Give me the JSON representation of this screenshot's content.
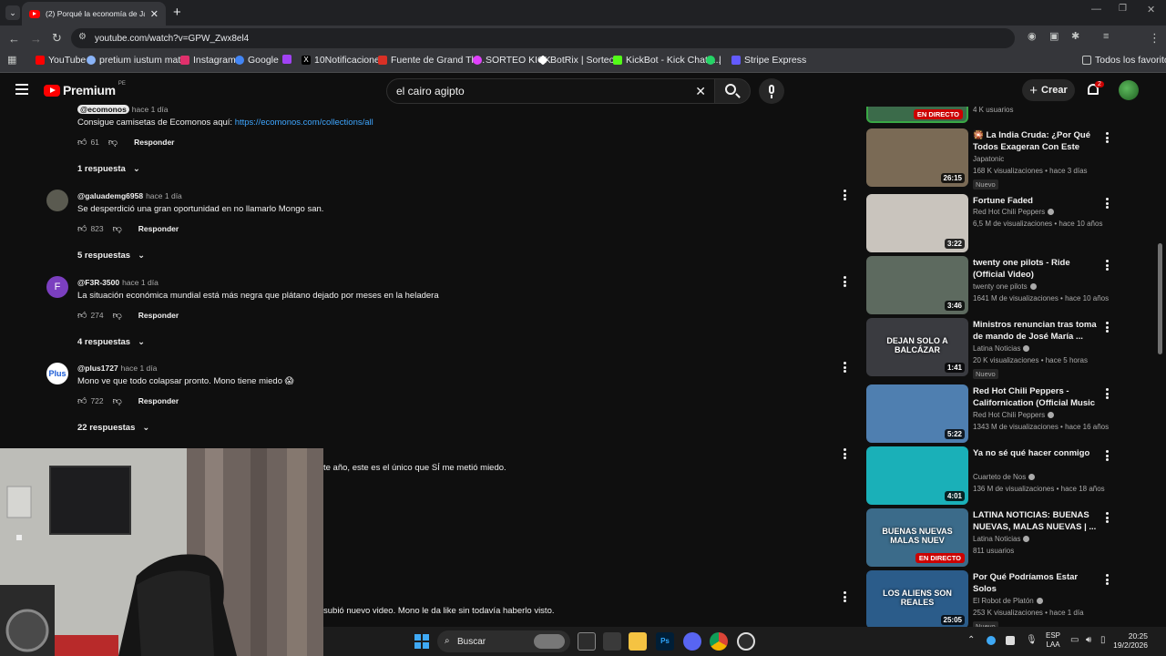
{
  "browser": {
    "tab_title": "(2) Porqué la economía de Japó",
    "url": "youtube.com/watch?v=GPW_Zwx8el4",
    "bookmarks": [
      {
        "label": "YouTube",
        "color": "#ff0000"
      },
      {
        "label": "pretium iustum mat...",
        "color": "#8ab4f8"
      },
      {
        "label": "Instagram",
        "color": "#e1306c"
      },
      {
        "label": "Google",
        "color": "#4285f4"
      },
      {
        "label": "",
        "color": "#a142f4"
      },
      {
        "label": "10Notificaciones",
        "color": "#ffffff"
      },
      {
        "label": "Fuente de Grand Th...",
        "color": "#d93025"
      },
      {
        "label": "SORTEO KICK",
        "color": "#e040fb"
      },
      {
        "label": "BotRix | Sorteos",
        "color": "#ffffff"
      },
      {
        "label": "KickBot - Kick Chatb...",
        "color": "#53fc18"
      },
      {
        "label": "|",
        "color": "#25d366"
      },
      {
        "label": "Stripe Express",
        "color": "#635bff"
      }
    ],
    "all_bookmarks": "Todos los favoritos"
  },
  "youtube": {
    "logo_text": "Premium",
    "region": "PE",
    "search_query": "el cairo agipto",
    "create_label": "Crear",
    "notif_count": "2"
  },
  "comments": [
    {
      "handle": "@ecomonos",
      "time": "hace 1 día",
      "text_prefix": "Consigue camisetas de Ecomonos aquí: ",
      "link": "https://ecomonos.com/collections/all",
      "likes": "61",
      "reply": "Responder",
      "replies": "1 respuesta"
    },
    {
      "handle": "@galuademg6958",
      "time": "hace 1 día",
      "text": "Se desperdició una gran oportunidad en no llamarlo Mongo san.",
      "likes": "823",
      "reply": "Responder",
      "replies": "5 respuestas"
    },
    {
      "handle": "@F3R-3500",
      "time": "hace 1 día",
      "avatar_letter": "F",
      "text": "La situación económica mundial está más negra que plátano dejado por meses en la heladera",
      "likes": "274",
      "reply": "Responder",
      "replies": "4 respuestas"
    },
    {
      "handle": "@plus1727",
      "time": "hace 1 día",
      "avatar_letter": "Plus",
      "text": "Mono ve que todo colapsar pronto. Mono tiene miedo 😱",
      "likes": "722",
      "reply": "Responder",
      "replies": "22 respuestas"
    },
    {
      "text_partial": "te año, este es el único que SÍ me metió miedo."
    },
    {
      "text_partial": "subió nuevo video. Mono le da like sin todavía haberlo visto."
    }
  ],
  "sidebar": {
    "top_partial_stats": "4 K usuarios",
    "top_partial_live": "EN DIRECTO",
    "videos": [
      {
        "title": "🎇 La India Cruda: ¿Por Qué Todos Exageran Con Este País?",
        "channel": "Japatonic",
        "verified": false,
        "stats": "168 K visualizaciones • hace 3 días",
        "badge": "Nuevo",
        "duration": "26:15",
        "thumb_color": "#7a6a55"
      },
      {
        "title": "Fortune Faded",
        "channel": "Red Hot Chili Peppers",
        "verified": true,
        "stats": "6,5 M de visualizaciones • hace 10 años",
        "duration": "3:22",
        "thumb_color": "#c9c4bd"
      },
      {
        "title": "twenty one pilots - Ride (Official Video)",
        "channel": "twenty one pilots",
        "verified": true,
        "stats": "1641 M de visualizaciones • hace 10 años",
        "duration": "3:46",
        "thumb_color": "#5d6a5f"
      },
      {
        "title": "Ministros renuncian tras toma de mando de José María ...",
        "channel": "Latina Noticias",
        "verified": true,
        "stats": "20 K visualizaciones • hace 5 horas",
        "badge": "Nuevo",
        "duration": "1:41",
        "thumb_color": "#3a3b40",
        "thumb_text": "DEJAN SOLO A BALCÁZAR"
      },
      {
        "title": "Red Hot Chili Peppers - Californication (Official Music ...",
        "channel": "Red Hot Chili Peppers",
        "verified": true,
        "stats": "1343 M de visualizaciones • hace 16 años",
        "duration": "5:22",
        "thumb_color": "#4f7fb0"
      },
      {
        "title": "Ya no sé qué hacer conmigo",
        "channel": "Cuarteto de Nos",
        "verified": true,
        "stats": "136 M de visualizaciones • hace 18 años",
        "duration": "4:01",
        "thumb_color": "#1ab0b8"
      },
      {
        "title": "LATINA NOTICIAS: BUENAS NUEVAS, MALAS NUEVAS | ...",
        "channel": "Latina Noticias",
        "verified": true,
        "stats": "811 usuarios",
        "live": "EN DIRECTO",
        "thumb_color": "#3b6b8a",
        "thumb_text": "BUENAS NUEVAS MALAS NUEV"
      },
      {
        "title": "Por Qué Podríamos Estar Solos",
        "channel": "El Robot de Platón",
        "verified": true,
        "stats": "253 K visualizaciones • hace 1 día",
        "badge": "Nuevo",
        "duration": "25:05",
        "thumb_color": "#2b5c8a",
        "thumb_text": "LOS ALIENS SON REALES"
      }
    ]
  },
  "taskbar": {
    "search_label": "Buscar",
    "lang": "ESP",
    "lang2": "LAA",
    "time": "20:25",
    "date": "19/2/2026"
  }
}
